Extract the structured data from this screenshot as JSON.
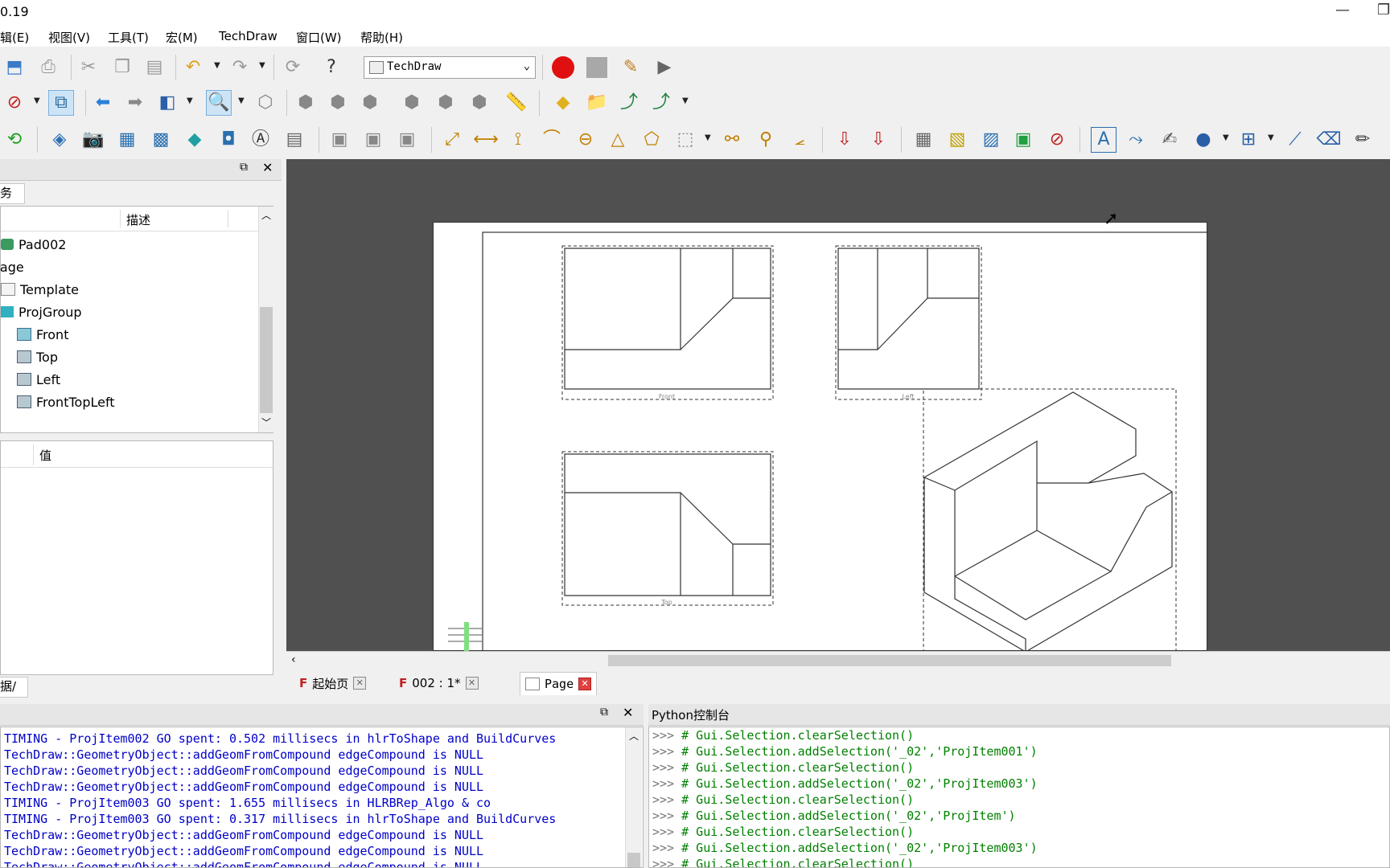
{
  "window": {
    "title": "0.19",
    "minimize": "—",
    "restore": "❐"
  },
  "menu": [
    "辑(E)",
    "视图(V)",
    "工具(T)",
    "宏(M)",
    "TechDraw",
    "窗口(W)",
    "帮助(H)"
  ],
  "toolbar": {
    "workbench": "TechDraw"
  },
  "combo_panel": {
    "tab_label": "务",
    "col_label": "",
    "col_desc": "描述"
  },
  "tree": [
    {
      "label": "Pad002",
      "indent": 0
    },
    {
      "label": "Page",
      "indent": 0
    },
    {
      "label": "Template",
      "indent": 1
    },
    {
      "label": "ProjGroup",
      "indent": 1
    },
    {
      "label": "Front",
      "indent": 2
    },
    {
      "label": "Top",
      "indent": 2
    },
    {
      "label": "Left",
      "indent": 2
    },
    {
      "label": "FrontTopLeft",
      "indent": 2
    }
  ],
  "properties": {
    "col_value": "值",
    "tab_label": "据"
  },
  "views": {
    "front_label": "Front",
    "left_label": "Left",
    "top_label": "Top"
  },
  "doc_tabs": [
    {
      "label": "起始页",
      "active": false
    },
    {
      "label": "002 : 1*",
      "active": false
    },
    {
      "label": "Page",
      "active": true
    }
  ],
  "python_console": {
    "title": "Python控制台",
    "prompt": ">>>",
    "lines": [
      "# Gui.Selection.clearSelection()",
      "# Gui.Selection.addSelection('_02','ProjItem001')",
      "# Gui.Selection.clearSelection()",
      "# Gui.Selection.addSelection('_02','ProjItem003')",
      "# Gui.Selection.clearSelection()",
      "# Gui.Selection.addSelection('_02','ProjItem')",
      "# Gui.Selection.clearSelection()",
      "# Gui.Selection.addSelection('_02','ProjItem003')",
      "# Gui.Selection.clearSelection()"
    ]
  },
  "report": {
    "lines": [
      "TIMING - ProjItem002 GO spent: 0.502 millisecs in hlrToShape and BuildCurves",
      "TechDraw::GeometryObject::addGeomFromCompound edgeCompound is NULL",
      "TechDraw::GeometryObject::addGeomFromCompound edgeCompound is NULL",
      "TechDraw::GeometryObject::addGeomFromCompound edgeCompound is NULL",
      "TIMING - ProjItem003 GO spent: 1.655 millisecs in HLRBRep_Algo & co",
      "TIMING - ProjItem003 GO spent: 0.317 millisecs in hlrToShape and BuildCurves",
      "TechDraw::GeometryObject::addGeomFromCompound edgeCompound is NULL",
      "TechDraw::GeometryObject::addGeomFromCompound edgeCompound is NULL",
      "TechDraw::GeometryObject::addGeomFromCompound edgeCompound is NULL"
    ]
  },
  "colors": {
    "canvas_bg": "#505050",
    "report_text": "#0000c8",
    "console_text": "#008000",
    "record_red": "#e01010"
  }
}
